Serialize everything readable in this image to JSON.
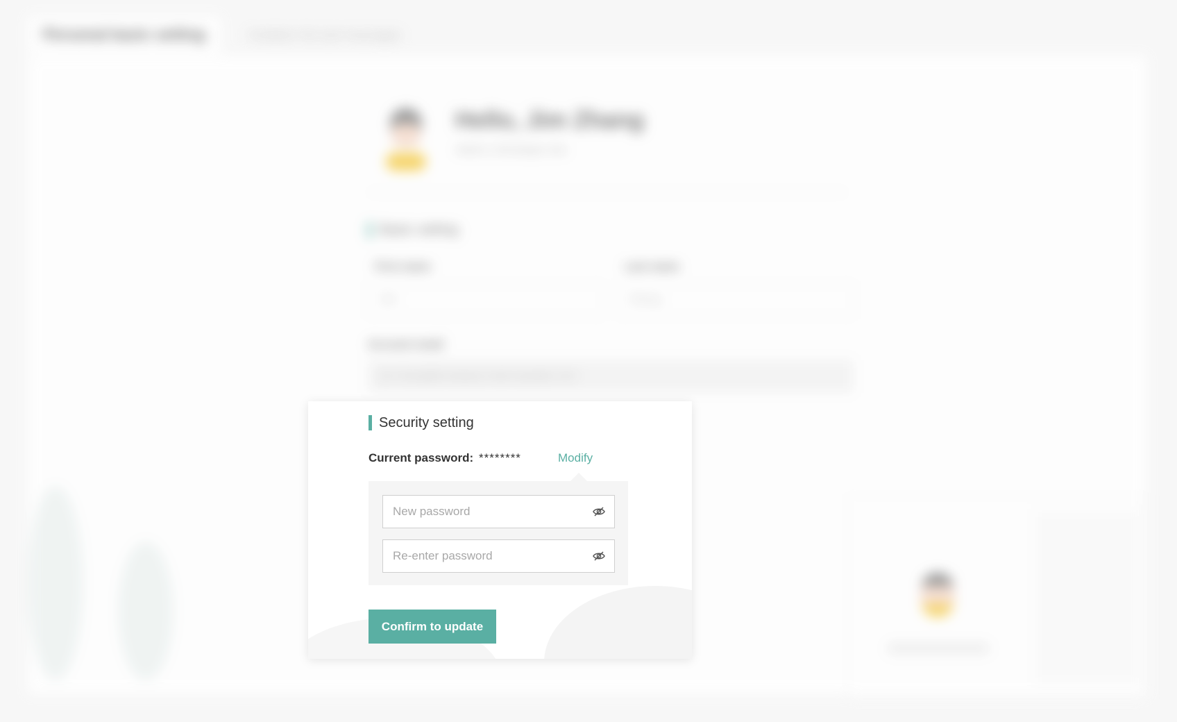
{
  "background": {
    "tabs": [
      "Personal basic setting",
      "Invitation list and messages"
    ],
    "hello": "Hello, Jim Zhang",
    "subtitle": "Admin  |  Developer dev",
    "section": "Basic setting",
    "first_name_label": "First name",
    "first_name_value": "Jim",
    "last_name_label": "Last name",
    "last_name_value": "Zhang",
    "account_label": "Account email",
    "account_value": "jim.zhang@company-mail.example.com"
  },
  "security": {
    "title": "Security setting",
    "current_password_label": "Current password:",
    "current_password_value": "********",
    "modify_label": "Modify",
    "new_password_placeholder": "New password",
    "reenter_password_placeholder": "Re-enter password",
    "confirm_label": "Confirm to update",
    "eye_icon": "eye-slash-icon"
  },
  "colors": {
    "accent": "#5aafa3",
    "panel": "#f5f5f5",
    "page_bg": "#f7f7f7"
  }
}
